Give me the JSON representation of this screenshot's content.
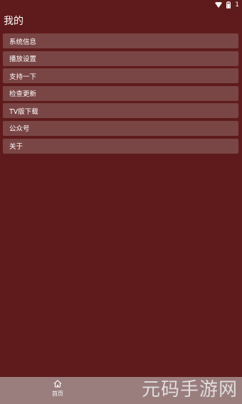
{
  "status_bar": {
    "icons": [
      "wifi-icon",
      "battery-icon"
    ],
    "text": "1"
  },
  "header": {
    "title": "我的"
  },
  "menu": {
    "items": [
      {
        "label": "系统信息"
      },
      {
        "label": "播放设置"
      },
      {
        "label": "支持一下"
      },
      {
        "label": "检查更新"
      },
      {
        "label": "TV版下载"
      },
      {
        "label": "公众号"
      },
      {
        "label": "关于"
      }
    ]
  },
  "bottom_nav": {
    "home_label": "首页",
    "home_icon": "home-icon"
  },
  "watermark": {
    "text": "元码手游网"
  },
  "colors": {
    "background": "#5f1b1b",
    "menu_item": "#7a4545",
    "bottom_nav": "#9a7d7d"
  }
}
